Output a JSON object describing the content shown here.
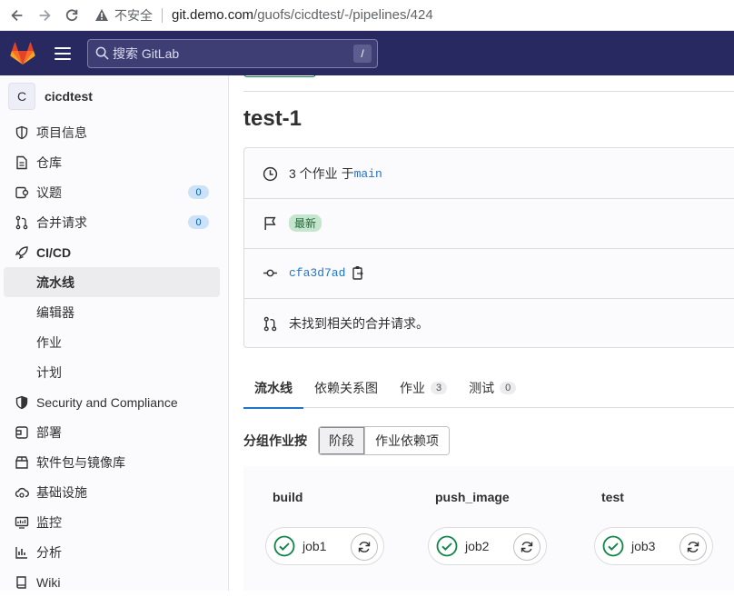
{
  "browser": {
    "security_label": "不安全",
    "url_host": "git.demo.com",
    "url_path": "/guofs/cicdtest/-/pipelines/424"
  },
  "header": {
    "search_placeholder": "搜索 GitLab",
    "search_shortcut": "/"
  },
  "project": {
    "avatar_letter": "C",
    "name": "cicdtest"
  },
  "sidebar": {
    "items": [
      {
        "label": "项目信息",
        "icon": "info-icon"
      },
      {
        "label": "仓库",
        "icon": "document-icon"
      },
      {
        "label": "议题",
        "icon": "issues-icon",
        "badge": "0"
      },
      {
        "label": "合并请求",
        "icon": "merge-request-icon",
        "badge": "0"
      },
      {
        "label": "CI/CD",
        "icon": "rocket-icon"
      },
      {
        "label": "Security and Compliance",
        "icon": "shield-icon"
      },
      {
        "label": "部署",
        "icon": "deploy-icon"
      },
      {
        "label": "软件包与镜像库",
        "icon": "package-icon"
      },
      {
        "label": "基础设施",
        "icon": "cloud-gear-icon"
      },
      {
        "label": "监控",
        "icon": "monitor-icon"
      },
      {
        "label": "分析",
        "icon": "chart-icon"
      },
      {
        "label": "Wiki",
        "icon": "book-icon"
      }
    ],
    "cicd_sub": [
      "流水线",
      "编辑器",
      "作业",
      "计划"
    ]
  },
  "pipeline": {
    "title": "test-1",
    "jobs_count_text": "3 个作业 于",
    "branch": "main",
    "latest_badge": "最新",
    "commit_sha": "cfa3d7ad",
    "mr_text": "未找到相关的合并请求。"
  },
  "tabs": [
    {
      "label": "流水线"
    },
    {
      "label": "依赖关系图"
    },
    {
      "label": "作业",
      "count": "3"
    },
    {
      "label": "测试",
      "count": "0"
    }
  ],
  "groupby": {
    "label": "分组作业按",
    "options": [
      "阶段",
      "作业依赖项"
    ]
  },
  "stages": [
    {
      "name": "build",
      "job": "job1"
    },
    {
      "name": "push_image",
      "job": "job2"
    },
    {
      "name": "test",
      "job": "job3"
    }
  ],
  "colors": {
    "header_bg": "#292961",
    "success": "#108548",
    "link": "#1f75cb",
    "active_tab": "#1f75cb"
  }
}
